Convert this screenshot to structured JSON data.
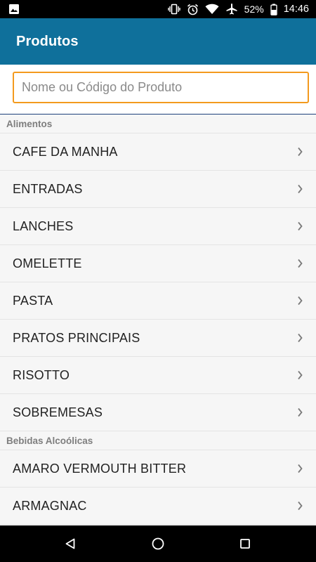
{
  "status_bar": {
    "battery_percent": "52%",
    "time": "14:46",
    "icons": [
      "image-icon",
      "vibrate-icon",
      "alarm-icon",
      "wifi-icon",
      "airplane-icon",
      "battery-icon"
    ]
  },
  "app_bar": {
    "title": "Produtos",
    "color": "#0f709b"
  },
  "search": {
    "placeholder": "Nome ou Código do Produto",
    "value": "",
    "border_color": "#f39a1e"
  },
  "sections": [
    {
      "header": "Alimentos",
      "items": [
        {
          "label": "CAFE DA MANHA"
        },
        {
          "label": "ENTRADAS"
        },
        {
          "label": "LANCHES"
        },
        {
          "label": "OMELETTE"
        },
        {
          "label": "PASTA"
        },
        {
          "label": "PRATOS PRINCIPAIS"
        },
        {
          "label": "RISOTTO"
        },
        {
          "label": "SOBREMESAS"
        }
      ]
    },
    {
      "header": "Bebidas Alcoólicas",
      "items": [
        {
          "label": "AMARO VERMOUTH BITTER"
        },
        {
          "label": "ARMAGNAC"
        }
      ]
    }
  ],
  "nav_bar": {
    "buttons": [
      "back-icon",
      "home-icon",
      "recents-icon"
    ]
  }
}
